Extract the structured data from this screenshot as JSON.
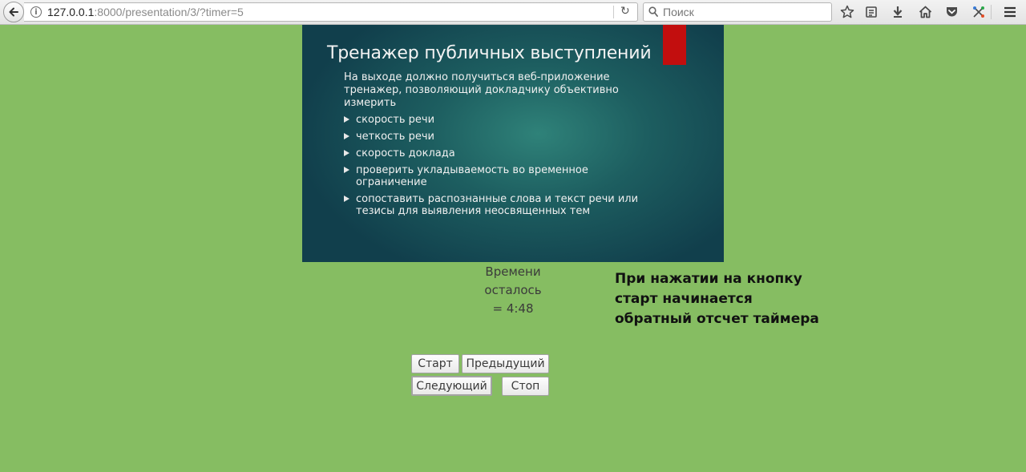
{
  "browser": {
    "url_host": "127.0.0.1",
    "url_rest": ":8000/presentation/3/?timer=5",
    "search_placeholder": "Поиск",
    "icons": [
      "back-arrow-icon",
      "info-icon",
      "reload-icon",
      "search-icon",
      "bookmark-star-icon",
      "reading-list-icon",
      "download-icon",
      "home-icon",
      "pocket-icon",
      "extension-icon",
      "menu-icon"
    ]
  },
  "slide": {
    "title": "Тренажер публичных выступлений",
    "intro": "На выходе должно получиться веб-приложение тренажер, позволяющий докладчику объективно измерить",
    "bullets": [
      "скорость речи",
      "четкость речи",
      "скорость доклада",
      "проверить укладываемость во временное ограничение",
      "сопоставить распознанные слова и текст речи или тезисы для выявления неосвященных тем"
    ],
    "accent_color": "#c20e0e"
  },
  "timer": {
    "line1": "Времени",
    "line2": "осталось",
    "line3": "= 4:48"
  },
  "annotation": {
    "line1": "При нажатии на кнопку",
    "line2": "старт начинается",
    "line3": "обратный отсчет таймера"
  },
  "controls": {
    "start": "Старт",
    "previous": "Предыдущий",
    "next": "Следующий",
    "stop": "Стоп"
  },
  "colors": {
    "page_background": "#86bd62"
  }
}
